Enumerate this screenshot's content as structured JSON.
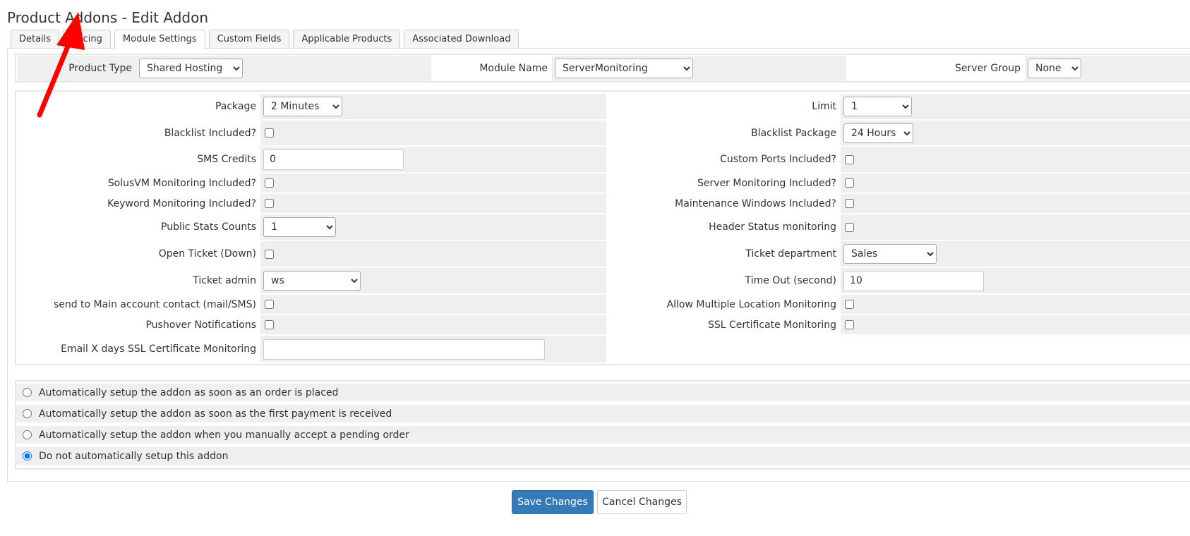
{
  "page": {
    "title": "Product Addons - Edit Addon"
  },
  "tabs": [
    {
      "label": "Details"
    },
    {
      "label": "Pricing"
    },
    {
      "label": "Module Settings"
    },
    {
      "label": "Custom Fields"
    },
    {
      "label": "Applicable Products"
    },
    {
      "label": "Associated Download"
    }
  ],
  "top": {
    "product_type_label": "Product Type",
    "product_type_value": "Shared Hosting",
    "module_name_label": "Module Name",
    "module_name_value": "ServerMonitoring",
    "server_group_label": "Server Group",
    "server_group_value": "None"
  },
  "settings": {
    "package_label": "Package",
    "package_value": "2 Minutes",
    "limit_label": "Limit",
    "limit_value": "1",
    "blacklist_included_label": "Blacklist Included?",
    "blacklist_package_label": "Blacklist Package",
    "blacklist_package_value": "24 Hours",
    "sms_credits_label": "SMS Credits",
    "sms_credits_value": "0",
    "custom_ports_label": "Custom Ports Included?",
    "solusvm_label": "SolusVM Monitoring Included?",
    "server_monitoring_label": "Server Monitoring Included?",
    "keyword_label": "Keyword Monitoring Included?",
    "maintenance_label": "Maintenance Windows Included?",
    "public_stats_label": "Public Stats Counts",
    "public_stats_value": "1",
    "header_status_label": "Header Status monitoring",
    "open_ticket_label": "Open Ticket (Down)",
    "ticket_department_label": "Ticket department",
    "ticket_department_value": "Sales",
    "ticket_admin_label": "Ticket admin",
    "ticket_admin_value": "ws",
    "timeout_label": "Time Out (second)",
    "timeout_value": "10",
    "send_main_contact_label": "send to Main account contact (mail/SMS)",
    "allow_multi_location_label": "Allow Multiple Location Monitoring",
    "pushover_label": "Pushover Notifications",
    "ssl_cert_label": "SSL Certificate Monitoring",
    "email_ssl_label": "Email X days SSL Certificate Monitoring",
    "email_ssl_value": ""
  },
  "setup_options": [
    {
      "label": "Automatically setup the addon as soon as an order is placed",
      "checked": false
    },
    {
      "label": "Automatically setup the addon as soon as the first payment is received",
      "checked": false
    },
    {
      "label": "Automatically setup the addon when you manually accept a pending order",
      "checked": false
    },
    {
      "label": "Do not automatically setup this addon",
      "checked": true
    }
  ],
  "buttons": {
    "save": "Save Changes",
    "cancel": "Cancel Changes"
  },
  "colors": {
    "primary": "#337ab7",
    "annotation_arrow": "#ff0000",
    "cell_grey": "#efefef"
  }
}
